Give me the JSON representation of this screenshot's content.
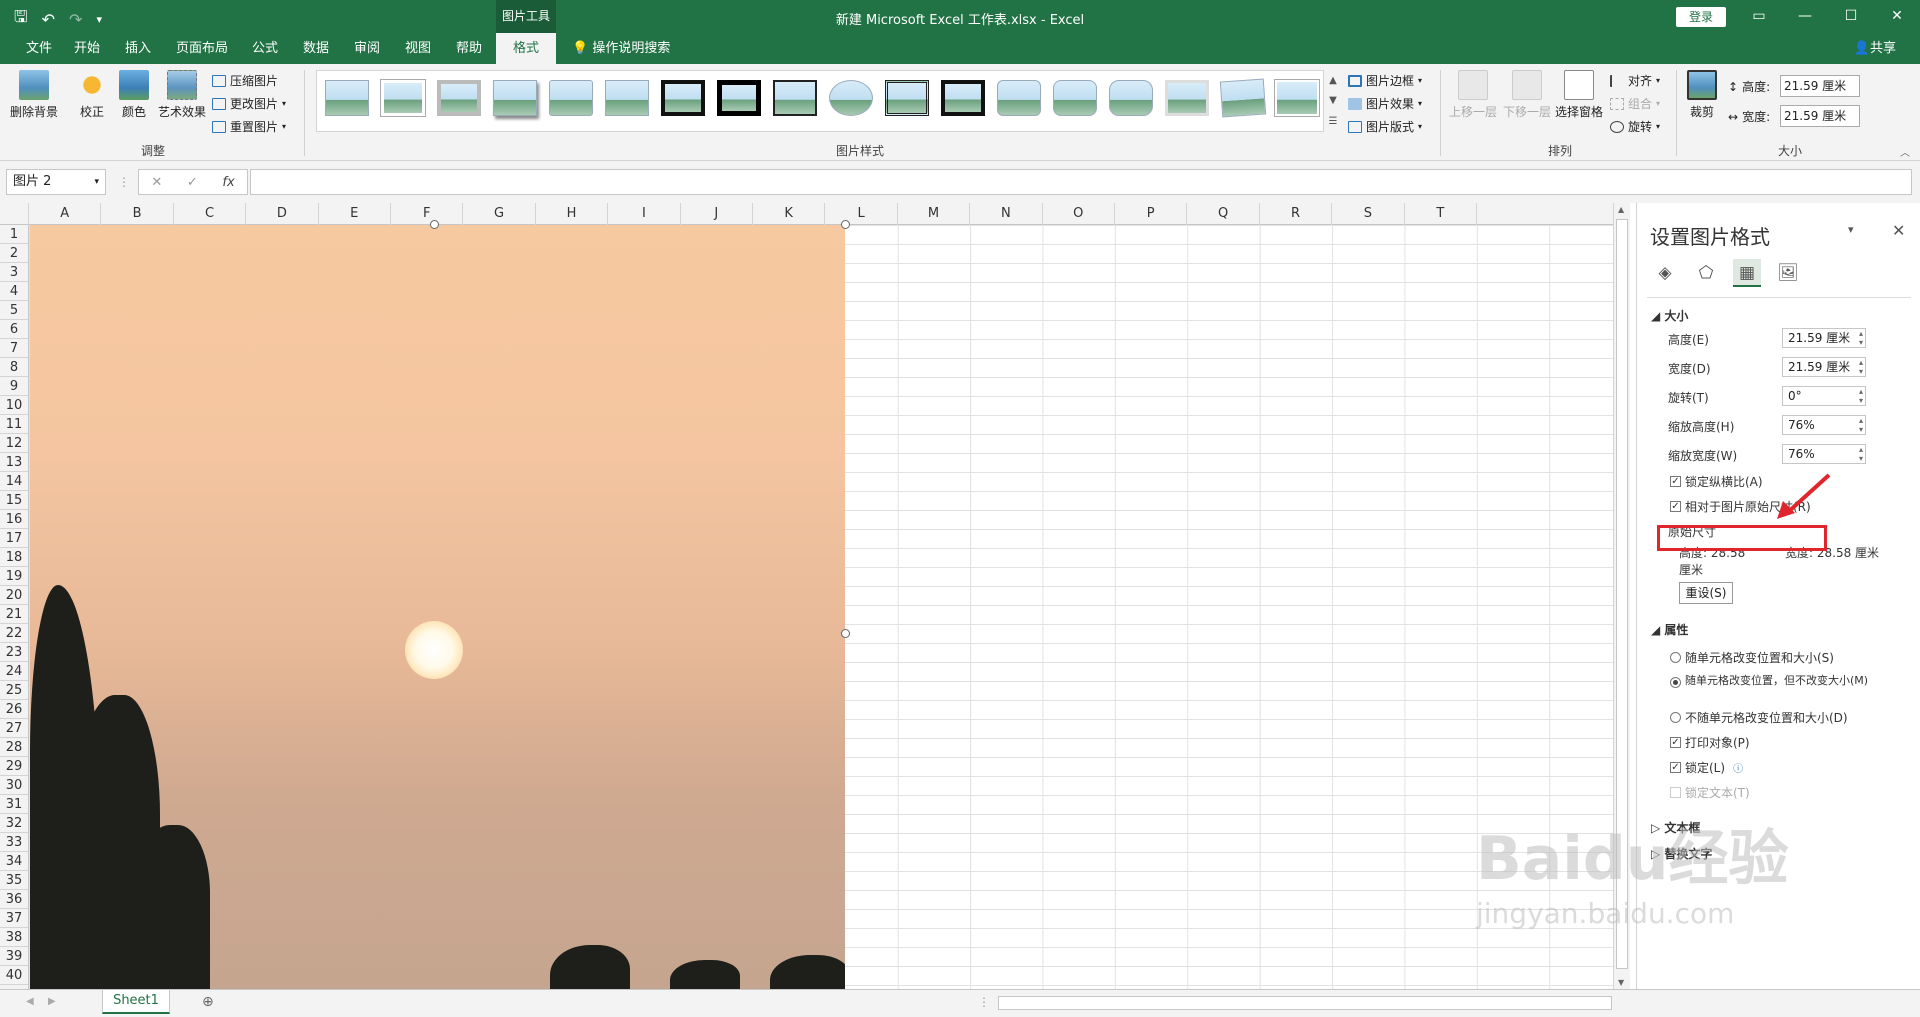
{
  "titlebar": {
    "picture_tools": "图片工具",
    "title": "新建 Microsoft Excel 工作表.xlsx  -  Excel",
    "login": "登录"
  },
  "tabs": [
    "文件",
    "开始",
    "插入",
    "页面布局",
    "公式",
    "数据",
    "审阅",
    "视图",
    "帮助",
    "格式"
  ],
  "active_tab": "格式",
  "tell_me": "操作说明搜索",
  "share": "共享",
  "ribbon": {
    "remove_bg": "删除背景",
    "corrections": "校正",
    "color": "颜色",
    "artistic": "艺术效果",
    "compress": "压缩图片",
    "change": "更改图片",
    "reset": "重置图片",
    "group_adjust": "调整",
    "group_styles": "图片样式",
    "border": "图片边框",
    "effects": "图片效果",
    "layout": "图片版式",
    "bring_forward": "上移一层",
    "send_backward": "下移一层",
    "selection_pane": "选择窗格",
    "align": "对齐",
    "group": "组合",
    "rotate": "旋转",
    "group_arrange": "排列",
    "crop": "裁剪",
    "height_label": "高度:",
    "height_value": "21.59 厘米",
    "width_label": "宽度:",
    "width_value": "21.59 厘米",
    "group_size": "大小"
  },
  "formula_bar": {
    "name_box": "图片 2",
    "fx": "fx",
    "formula": ""
  },
  "columns": [
    "A",
    "B",
    "C",
    "D",
    "E",
    "F",
    "G",
    "H",
    "I",
    "J",
    "K",
    "L",
    "M",
    "N",
    "O",
    "P",
    "Q",
    "R",
    "S",
    "T"
  ],
  "rows": [
    "1",
    "2",
    "3",
    "4",
    "5",
    "6",
    "7",
    "8",
    "9",
    "10",
    "11",
    "12",
    "13",
    "14",
    "15",
    "16",
    "17",
    "18",
    "19",
    "20",
    "21",
    "22",
    "23",
    "24",
    "25",
    "26",
    "27",
    "28",
    "29",
    "30",
    "31",
    "32",
    "33",
    "34",
    "35",
    "36",
    "37",
    "38",
    "39",
    "40"
  ],
  "sheet_tab": "Sheet1",
  "pane": {
    "title": "设置图片格式",
    "size_section": "大小",
    "height_label": "高度(E)",
    "height_value": "21.59 厘米",
    "width_label": "宽度(D)",
    "width_value": "21.59 厘米",
    "rotation_label": "旋转(T)",
    "rotation_value": "0°",
    "scale_h_label": "缩放高度(H)",
    "scale_h_value": "76%",
    "scale_w_label": "缩放宽度(W)",
    "scale_w_value": "76%",
    "lock_ratio": "锁定纵横比(A)",
    "relative_original": "相对于图片原始尺寸(R)",
    "original_size": "原始尺寸",
    "orig_height_label": "高度:",
    "orig_height_value": "28.58 厘米",
    "orig_width_label": "宽度:",
    "orig_width_value": "28.58 厘米",
    "reset_button": "重设(S)",
    "properties_section": "属性",
    "radio1": "随单元格改变位置和大小(S)",
    "radio2": "随单元格改变位置，但不改变大小(M)",
    "radio3": "不随单元格改变位置和大小(D)",
    "print_object": "打印对象(P)",
    "locked": "锁定(L)",
    "lock_text": "锁定文本(T)",
    "textbox_section": "文本框",
    "alt_text_section": "替换文字"
  },
  "watermark": {
    "brand": "Baidu经验",
    "url": "jingyan.baidu.com"
  }
}
